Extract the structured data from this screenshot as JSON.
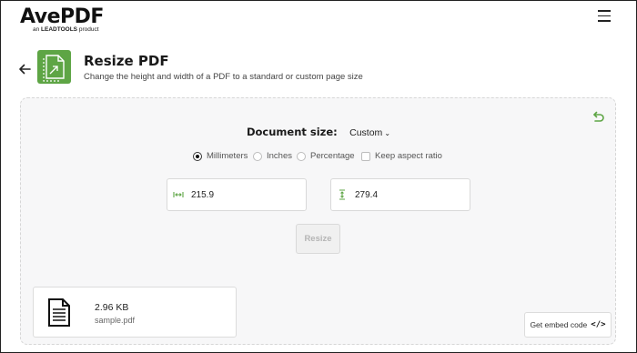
{
  "brand": {
    "logo": "AvePDF",
    "tagline_prefix": "an",
    "tagline_brand": "LEADTOOLS",
    "tagline_suffix": "product"
  },
  "tool": {
    "title": "Resize PDF",
    "description": "Change the height and width of a PDF to a standard or custom page size",
    "accent_color": "#5ea545"
  },
  "form": {
    "document_size_label": "Document size:",
    "document_size_value": "Custom",
    "units": [
      {
        "label": "Millimeters",
        "selected": true
      },
      {
        "label": "Inches",
        "selected": false
      },
      {
        "label": "Percentage",
        "selected": false
      }
    ],
    "keep_aspect_ratio_label": "Keep aspect ratio",
    "keep_aspect_ratio_checked": false,
    "width_value": "215.9",
    "height_value": "279.4",
    "resize_label": "Resize"
  },
  "file": {
    "size": "2.96 KB",
    "name": "sample.pdf"
  },
  "embed": {
    "label": "Get embed code",
    "code_glyph": "</>"
  }
}
